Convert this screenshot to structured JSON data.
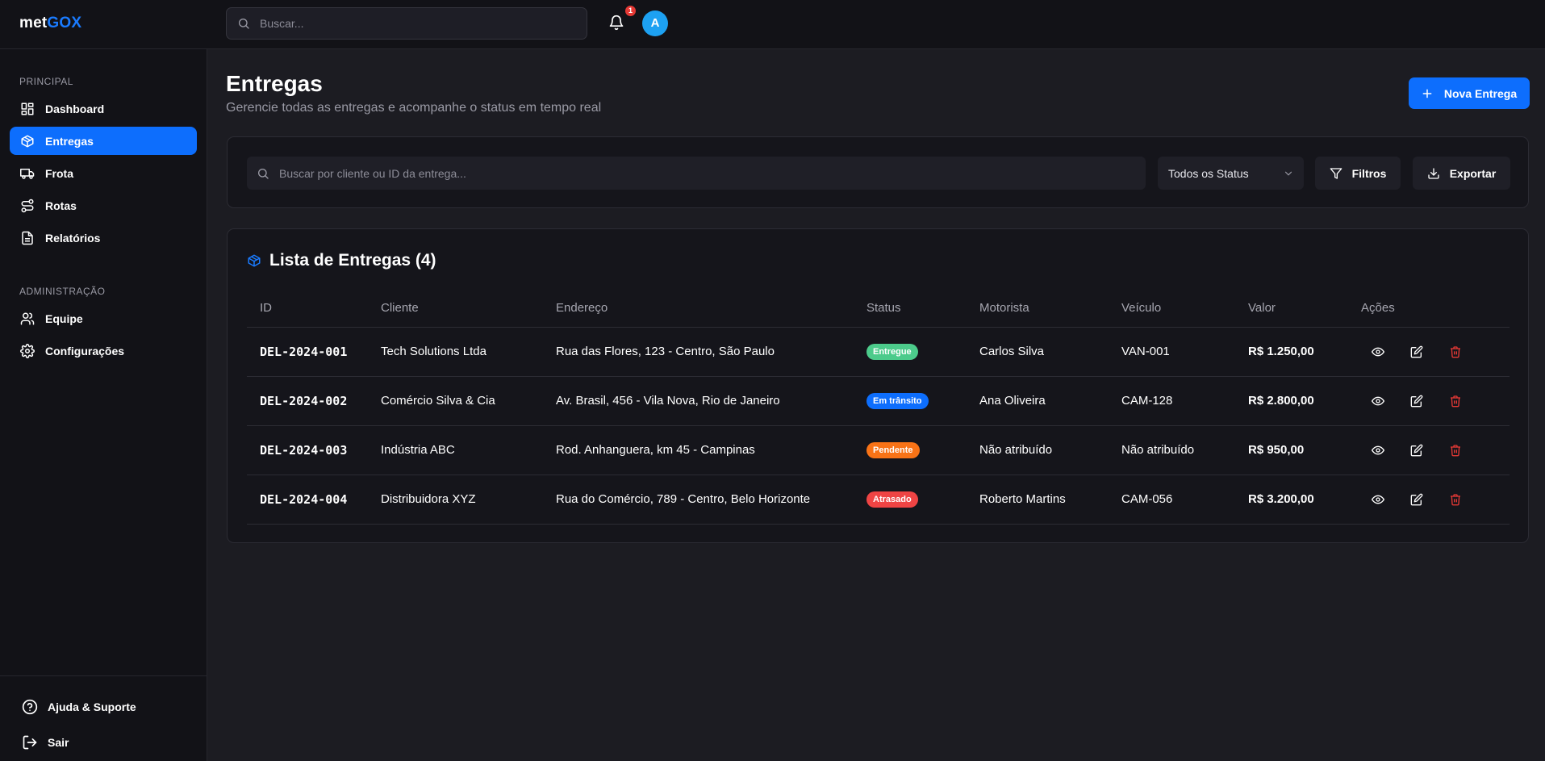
{
  "app": {
    "logo_part1": "met",
    "logo_part2": "GOX",
    "search_placeholder": "Buscar...",
    "notification_count": "1",
    "avatar_initial": "A"
  },
  "sidebar": {
    "section_principal": "PRINCIPAL",
    "section_admin": "ADMINISTRAÇÃO",
    "items": [
      {
        "label": "Dashboard",
        "icon": "dashboard-icon"
      },
      {
        "label": "Entregas",
        "icon": "package-icon",
        "active": true
      },
      {
        "label": "Frota",
        "icon": "truck-icon"
      },
      {
        "label": "Rotas",
        "icon": "route-icon"
      },
      {
        "label": "Relatórios",
        "icon": "report-icon"
      }
    ],
    "admin_items": [
      {
        "label": "Equipe",
        "icon": "users-icon"
      },
      {
        "label": "Configurações",
        "icon": "gear-icon"
      }
    ],
    "footer": {
      "help": "Ajuda & Suporte",
      "logout": "Sair"
    }
  },
  "page": {
    "title": "Entregas",
    "subtitle": "Gerencie todas as entregas e acompanhe o status em tempo real",
    "new_button": "Nova Entrega"
  },
  "filters": {
    "search_placeholder": "Buscar por cliente ou ID da entrega...",
    "status_selected": "Todos os Status",
    "filters_button": "Filtros",
    "export_button": "Exportar"
  },
  "list": {
    "title": "Lista de Entregas (4)",
    "columns": [
      "ID",
      "Cliente",
      "Endereço",
      "Status",
      "Motorista",
      "Veículo",
      "Valor",
      "Ações"
    ],
    "rows": [
      {
        "id": "DEL-2024-001",
        "cliente": "Tech Solutions Ltda",
        "endereco": "Rua das Flores, 123 - Centro, São Paulo",
        "status": "Entregue",
        "status_color": "#4ccb8b",
        "motorista": "Carlos Silva",
        "veiculo": "VAN-001",
        "valor": "R$ 1.250,00"
      },
      {
        "id": "DEL-2024-002",
        "cliente": "Comércio Silva & Cia",
        "endereco": "Av. Brasil, 456 - Vila Nova, Rio de Janeiro",
        "status": "Em trânsito",
        "status_color": "#0d6efd",
        "motorista": "Ana Oliveira",
        "veiculo": "CAM-128",
        "valor": "R$ 2.800,00"
      },
      {
        "id": "DEL-2024-003",
        "cliente": "Indústria ABC",
        "endereco": "Rod. Anhanguera, km 45 - Campinas",
        "status": "Pendente",
        "status_color": "#f97316",
        "motorista": "Não atribuído",
        "veiculo": "Não atribuído",
        "valor": "R$ 950,00"
      },
      {
        "id": "DEL-2024-004",
        "cliente": "Distribuidora XYZ",
        "endereco": "Rua do Comércio, 789 - Centro, Belo Horizonte",
        "status": "Atrasado",
        "status_color": "#ef4444",
        "motorista": "Roberto Martins",
        "veiculo": "CAM-056",
        "valor": "R$ 3.200,00"
      }
    ]
  },
  "colors": {
    "accent": "#0d6efd",
    "danger": "#e53935",
    "background": "#1c1c22",
    "sidebar": "#121217"
  }
}
